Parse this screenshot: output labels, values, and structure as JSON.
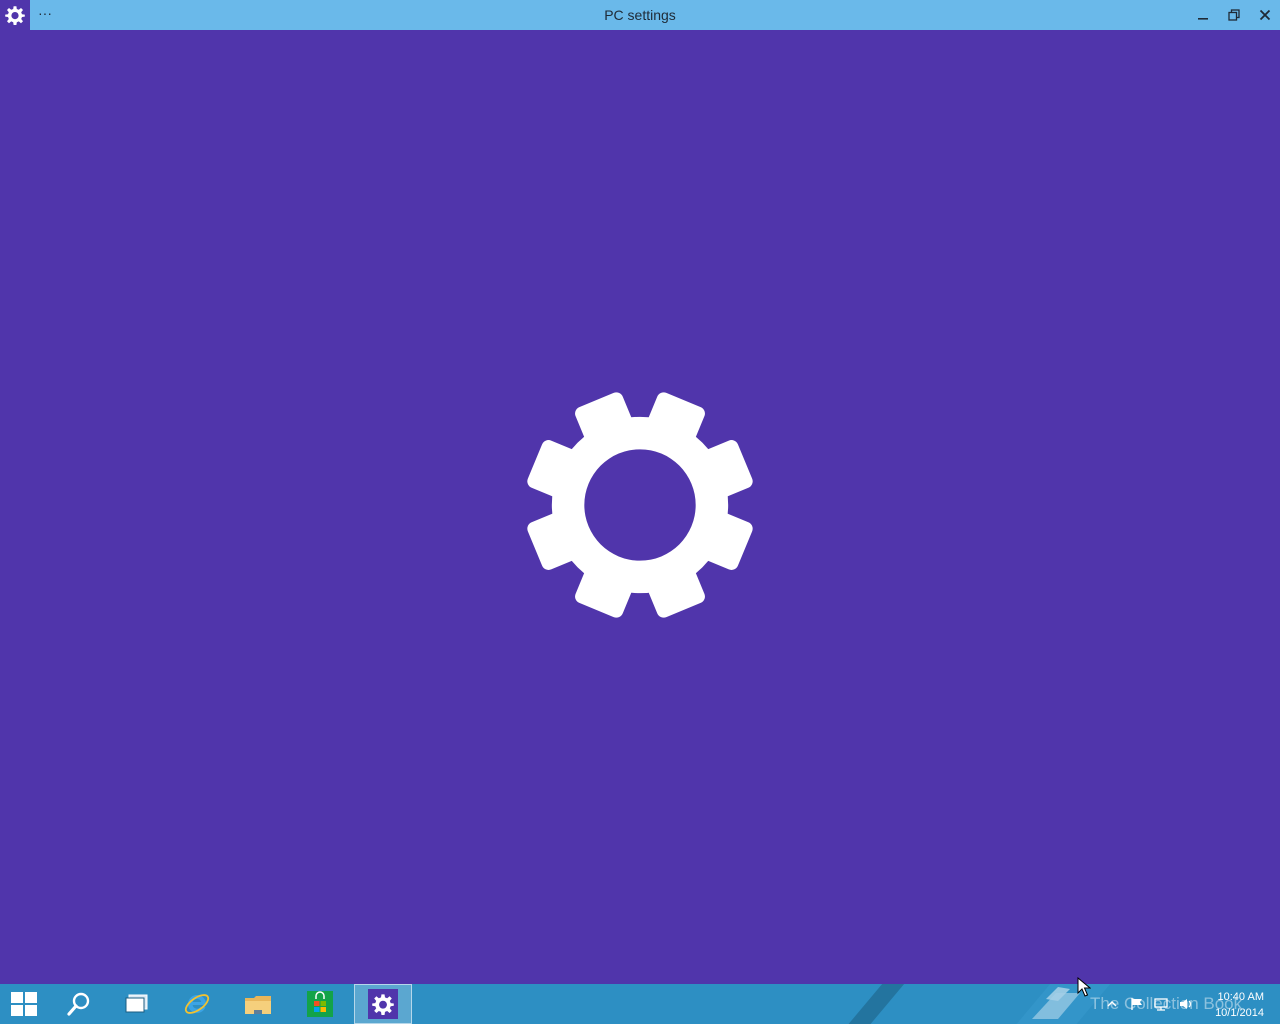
{
  "window": {
    "title": "PC settings",
    "app_icon": "gear-icon",
    "menu_label": "···",
    "controls": [
      "minimize-icon",
      "restore-icon",
      "close-icon"
    ]
  },
  "splash": {
    "icon": "gear-icon",
    "background_color": "#5035ab",
    "icon_color": "#ffffff"
  },
  "taskbar": {
    "items": [
      {
        "name": "start",
        "icon": "windows-logo-icon"
      },
      {
        "name": "search",
        "icon": "search-icon"
      },
      {
        "name": "task-view",
        "icon": "task-view-icon"
      },
      {
        "name": "internet-explorer",
        "icon": "internet-explorer-icon"
      },
      {
        "name": "file-explorer",
        "icon": "folder-icon"
      },
      {
        "name": "store",
        "icon": "store-bag-icon"
      },
      {
        "name": "pc-settings",
        "icon": "gear-icon",
        "active": true
      }
    ],
    "watermark_text": "The Collection Book",
    "tray_icons": [
      "show-hidden-icons-chevron-icon",
      "action-center-flag-icon",
      "network-icon",
      "volume-icon"
    ],
    "clock": {
      "time": "10:40 AM",
      "date": "10/1/2014"
    },
    "bar_color": "#2d8fc3"
  },
  "titlebar_color": "#6ab9ea"
}
